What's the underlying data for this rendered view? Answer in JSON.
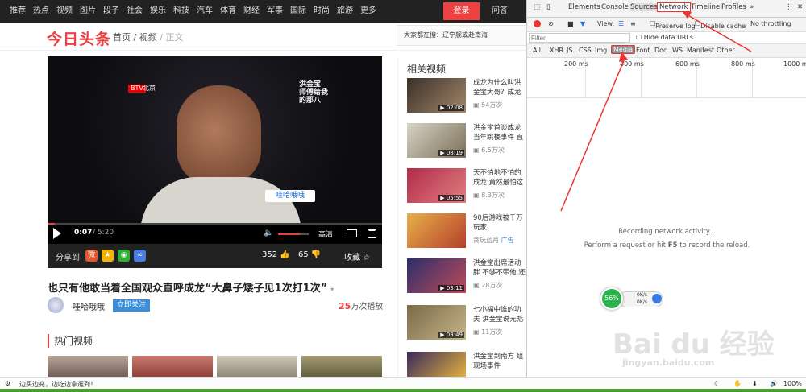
{
  "topnav": {
    "items": [
      "推荐",
      "热点",
      "视频",
      "图片",
      "段子",
      "社会",
      "娱乐",
      "科技",
      "汽车",
      "体育",
      "财经",
      "军事",
      "国际",
      "时尚",
      "旅游",
      "更多"
    ],
    "login": "登录",
    "help": "问答"
  },
  "header": {
    "logo": "今日头条",
    "breadcrumb": {
      "home": "首页",
      "sep1": "/",
      "section": "视频",
      "sep2": "/",
      "current": "正文"
    },
    "search_hint": "大家都在搜：辽宁舰或赴南海"
  },
  "player": {
    "channel_badge": "BTV",
    "channel_name": "北京",
    "overlay_text": "洪金宝 师傅给我的那八",
    "name_caption": "哇哈哦哦",
    "time_current": "0:07",
    "time_total": "/ 5:20",
    "progress": 0.022,
    "volume": 0.7,
    "quality": "高清"
  },
  "share": {
    "label": "分享到",
    "like_count": "352",
    "dislike_count": "65",
    "favorite_label": "收藏"
  },
  "video": {
    "title": "也只有他敢当着全国观众直呼成龙“大鼻子矮子见1次打1次”",
    "author": "哇哈哦哦",
    "follow_label": "立即关注",
    "plays_number": "25",
    "plays_suffix": "万次播放"
  },
  "hot": {
    "label": "热门视频"
  },
  "related": {
    "title": "相关视频",
    "items": [
      {
        "title": "成龙为什么叫洪金宝大哥？成龙大哥是这样说的",
        "duration": "02:08",
        "views": "54万次",
        "ad": ""
      },
      {
        "title": "洪金宝首谈成龙当年跳楼事件 直言成龙",
        "duration": "08:19",
        "views": "6.5万次",
        "ad": ""
      },
      {
        "title": "天不怕地不怕的成龙 竟然最怕这个，",
        "duration": "05:55",
        "views": "8.3万次",
        "ad": ""
      },
      {
        "title": "90后游戏被千万玩家",
        "duration": "",
        "views": "贪玩蓝月",
        "ad": "广告"
      },
      {
        "title": "洪金宝出席活动 胖 不够不带他 还",
        "duration": "03:11",
        "views": "28万次",
        "ad": ""
      },
      {
        "title": "七小福中谁的功夫 洪金宝说元彪",
        "duration": "03:49",
        "views": "11万次",
        "ad": ""
      },
      {
        "title": "洪金宝到南方 组现场事件",
        "duration": "",
        "views": "",
        "ad": ""
      }
    ]
  },
  "devtools": {
    "tabs": [
      "Elements",
      "Console",
      "Sources",
      "Network",
      "Timeline",
      "Profiles"
    ],
    "more": "»",
    "view_label": "View:",
    "preserve_log": "Preserve log",
    "disable_cache": "Disable cache",
    "throttling": "No throttling",
    "filter_placeholder": "Filter",
    "hide_data_urls": "Hide data URLs",
    "types": [
      "All",
      "XHR",
      "JS",
      "CSS",
      "Img",
      "Media",
      "Font",
      "Doc",
      "WS",
      "Manifest",
      "Other"
    ],
    "timeline_labels": [
      "200 ms",
      "400 ms",
      "600 ms",
      "800 ms",
      "1000 ms"
    ],
    "recording_msg": "Recording network activity...",
    "reload_msg_pre": "Perform a request or hit ",
    "reload_key": "F5",
    "reload_msg_post": " to record the reload."
  },
  "speed_widget": {
    "percent": "56%",
    "up": "0K/s",
    "down": "0K/s"
  },
  "watermark": {
    "brand": "Bai du 经验",
    "url": "jingyan.baidu.com"
  },
  "statusbar": {
    "left": "边买边充，边吃边拿逛到！",
    "zoom": "100%"
  },
  "colors": {
    "brand_red": "#ed4040",
    "devtools_bg": "#f3f3f3",
    "follow_blue": "#3b8fd8",
    "taskbar_green": "#4a9b2e"
  }
}
